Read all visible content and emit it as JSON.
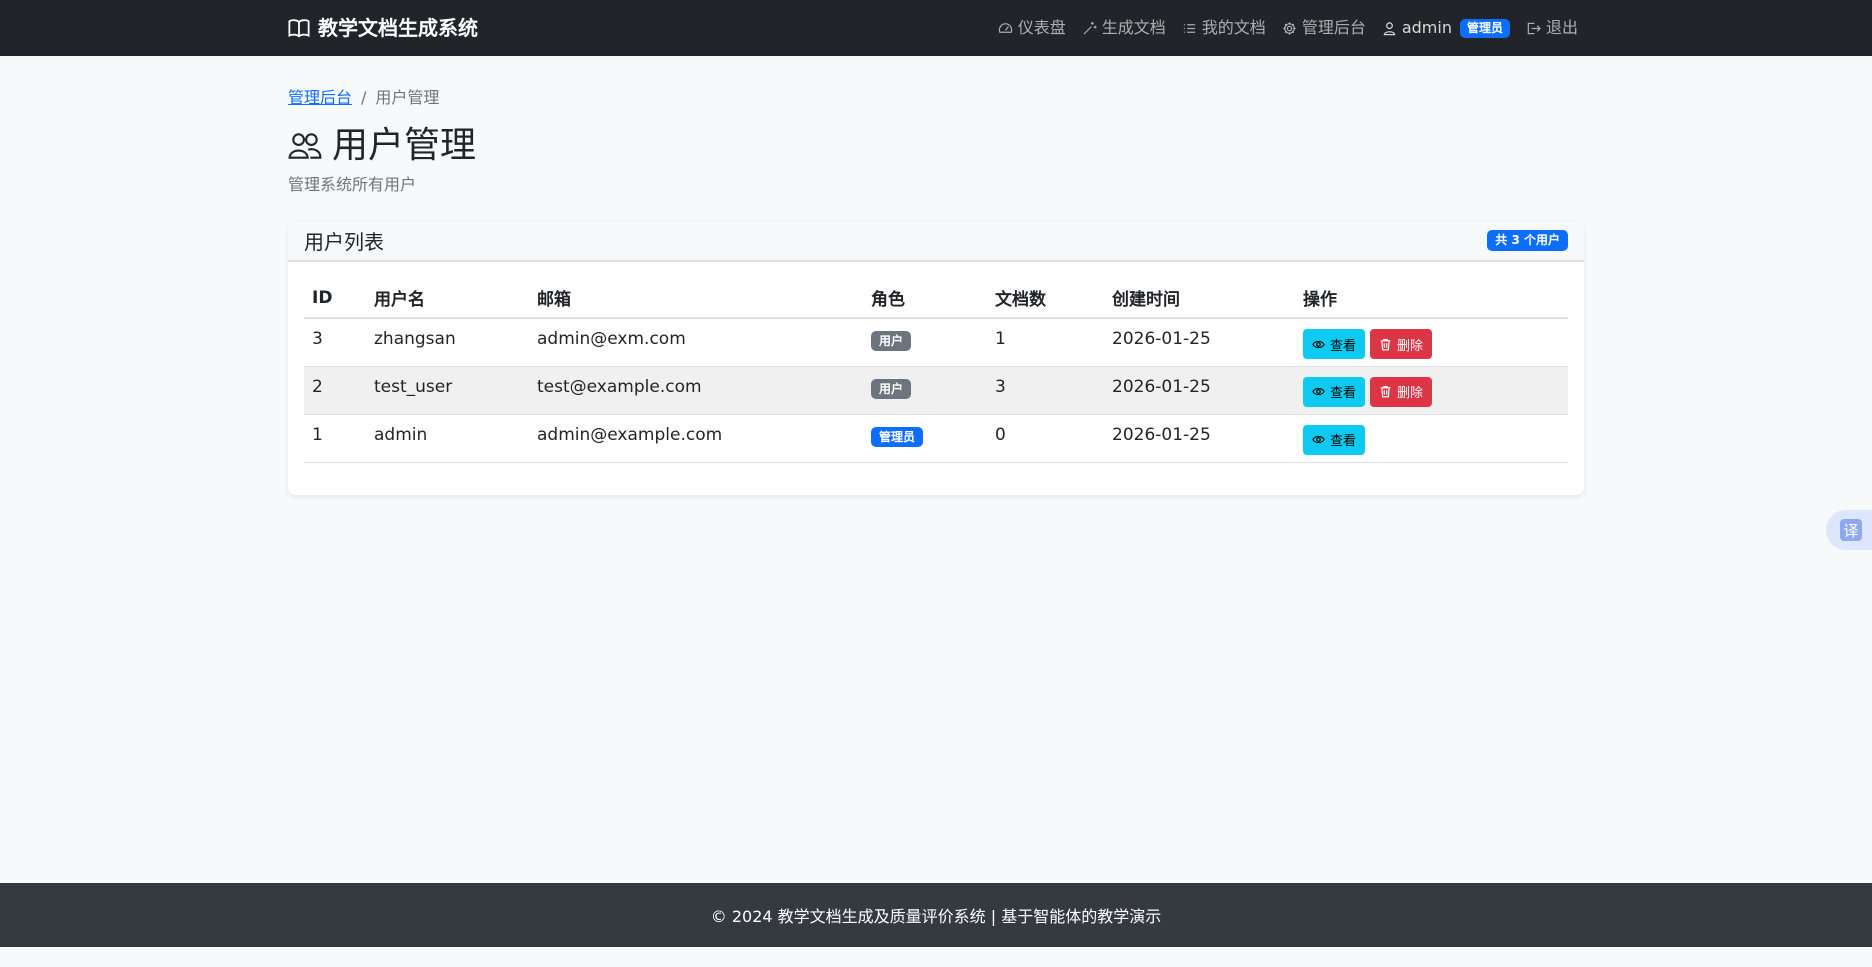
{
  "navbar": {
    "brand": "教学文档生成系统",
    "items": [
      {
        "label": "仪表盘",
        "icon": "speedometer-icon"
      },
      {
        "label": "生成文档",
        "icon": "magic-wand-icon"
      },
      {
        "label": "我的文档",
        "icon": "list-icon"
      },
      {
        "label": "管理后台",
        "icon": "gear-icon"
      }
    ],
    "user": {
      "name": "admin",
      "badge": "管理员"
    },
    "logout": "退出"
  },
  "breadcrumb": {
    "parent": "管理后台",
    "separator": "/",
    "current": "用户管理"
  },
  "page": {
    "title": "用户管理",
    "subtitle": "管理系统所有用户"
  },
  "card": {
    "title": "用户列表",
    "count_badge": "共 3 个用户",
    "columns": [
      "ID",
      "用户名",
      "邮箱",
      "角色",
      "文档数",
      "创建时间",
      "操作"
    ],
    "rows": [
      {
        "id": "3",
        "username": "zhangsan",
        "email": "admin@exm.com",
        "role": "用户",
        "docs": "1",
        "created": "2026-01-25",
        "view": "查看",
        "delete": "删除"
      },
      {
        "id": "2",
        "username": "test_user",
        "email": "test@example.com",
        "role": "用户",
        "docs": "3",
        "created": "2026-01-25",
        "view": "查看",
        "delete": "删除"
      },
      {
        "id": "1",
        "username": "admin",
        "email": "admin@example.com",
        "role": "管理员",
        "docs": "0",
        "created": "2026-01-25",
        "view": "查看"
      }
    ]
  },
  "translate": {
    "glyph": "译"
  },
  "footer": {
    "text": "© 2024 教学文档生成及质量评价系统 | 基于智能体的教学演示"
  },
  "colors": {
    "navbar": "#212529",
    "primary": "#0d6efd",
    "info": "#0dcaf0",
    "danger": "#dc3545",
    "secondary": "#6c757d",
    "footer": "#343a40"
  }
}
